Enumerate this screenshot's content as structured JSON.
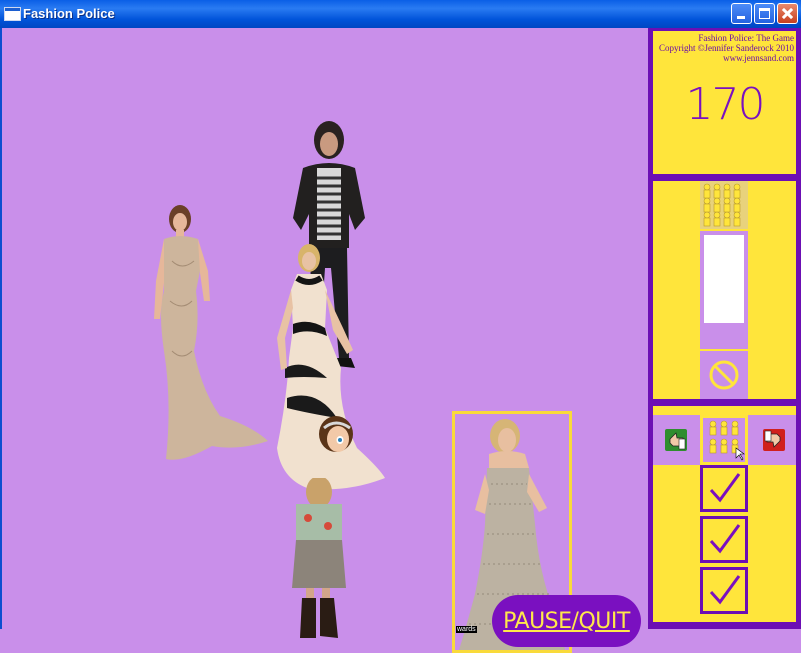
{
  "window": {
    "title": "Fashion Police"
  },
  "panel": {
    "credits_line1": "Fashion Police: The Game",
    "credits_line2": "Copyright ©Jennifer Sanderock 2010",
    "credits_line3": "www.jennsand.com",
    "score": "170",
    "meter_fill_fraction": 0.2,
    "checks_count": 3
  },
  "stage": {
    "pause_label": "PAUSE/QUIT",
    "photo_caption_fragment": "wards"
  },
  "colors": {
    "background": "#c98fea",
    "panel_purple": "#6c0fb4",
    "panel_yellow": "#ffe53b",
    "accent_purple": "#7a10c0",
    "selection_yellow": "#f9da3a"
  }
}
